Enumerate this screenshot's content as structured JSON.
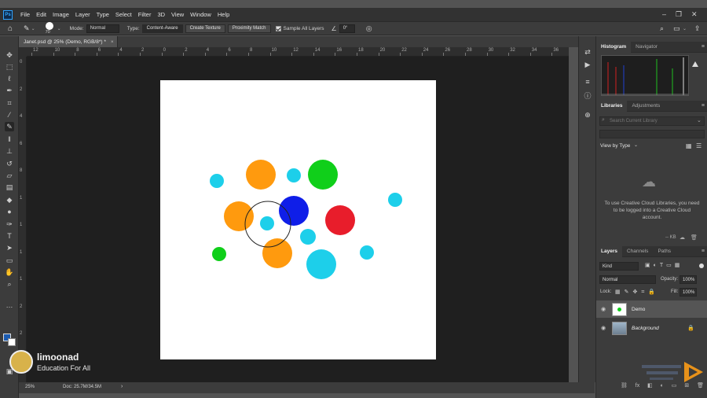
{
  "menubar": {
    "logo": "Ps",
    "items": [
      "File",
      "Edit",
      "Image",
      "Layer",
      "Type",
      "Select",
      "Filter",
      "3D",
      "View",
      "Window",
      "Help"
    ]
  },
  "options": {
    "brush_size": "70",
    "mode_label": "Mode:",
    "mode_value": "Normal",
    "type_label": "Type:",
    "type_buttons": [
      "Content-Aware",
      "Create Texture",
      "Proximity Match"
    ],
    "sample_all_layers": "Sample All Layers",
    "angle_value": "0°"
  },
  "document": {
    "tab_title": "Janet.psd @ 25% (Demo, RGB/8*) *",
    "zoom": "25%",
    "doc_size": "Doc: 25.7M/34.5M",
    "ruler_top_labels": [
      "12",
      "10",
      "8",
      "6",
      "4",
      "2",
      "0",
      "2",
      "4",
      "6",
      "8",
      "10",
      "12",
      "14",
      "16",
      "18",
      "20",
      "22",
      "24",
      "26",
      "28",
      "30",
      "32",
      "34",
      "36"
    ],
    "ruler_left_labels": [
      "0",
      "2",
      "4",
      "6",
      "8",
      "1",
      "1",
      "1",
      "1",
      "2",
      "2",
      "2"
    ]
  },
  "canvas": {
    "circles": [
      {
        "color": "#ff9a0e",
        "label": "orange"
      },
      {
        "color": "#1dcfea",
        "label": "cyan"
      },
      {
        "color": "#10cf1a",
        "label": "green"
      },
      {
        "color": "#1dcfea",
        "label": "cyan"
      },
      {
        "color": "#ff9a0e",
        "label": "orange"
      },
      {
        "color": "#0f1ee8",
        "label": "blue"
      },
      {
        "color": "#e81d2b",
        "label": "red"
      },
      {
        "color": "#1dcfea",
        "label": "cyan"
      },
      {
        "color": "#1dcfea",
        "label": "cyan"
      },
      {
        "color": "#1dcfea",
        "label": "cyan"
      },
      {
        "color": "#10cf1a",
        "label": "green"
      },
      {
        "color": "#ff9a0e",
        "label": "orange"
      },
      {
        "color": "#1dcfea",
        "label": "cyan"
      },
      {
        "color": "#1dcfea",
        "label": "cyan"
      }
    ],
    "brush_cursor": "circle-outline"
  },
  "brand": {
    "name": "limoonad",
    "tagline": "Education For All"
  },
  "panels": {
    "histogram_tabs": [
      "Histogram",
      "Navigator"
    ],
    "libraries_tabs": [
      "Libraries",
      "Adjustments"
    ],
    "library_search_placeholder": "Search Current Library",
    "view_by": "View by Type",
    "library_message": "To use Creative Cloud Libraries, you need to be logged into a Creative Cloud account.",
    "library_footer": "-- KB",
    "layers_tabs": [
      "Layers",
      "Channels",
      "Paths"
    ],
    "kind": "Kind",
    "blend_mode": "Normal",
    "opacity_label": "Opacity:",
    "opacity_value": "100%",
    "lock_label": "Lock:",
    "fill_label": "Fill:",
    "fill_value": "100%",
    "layers": [
      {
        "name": "Demo",
        "selected": true
      },
      {
        "name": "Background",
        "selected": false
      }
    ]
  },
  "colors": {
    "accent": "#31a8ff",
    "menubar_bg": "#323232",
    "panel_bg": "#3c3c3c",
    "pasteboard": "#1f1f1f"
  }
}
